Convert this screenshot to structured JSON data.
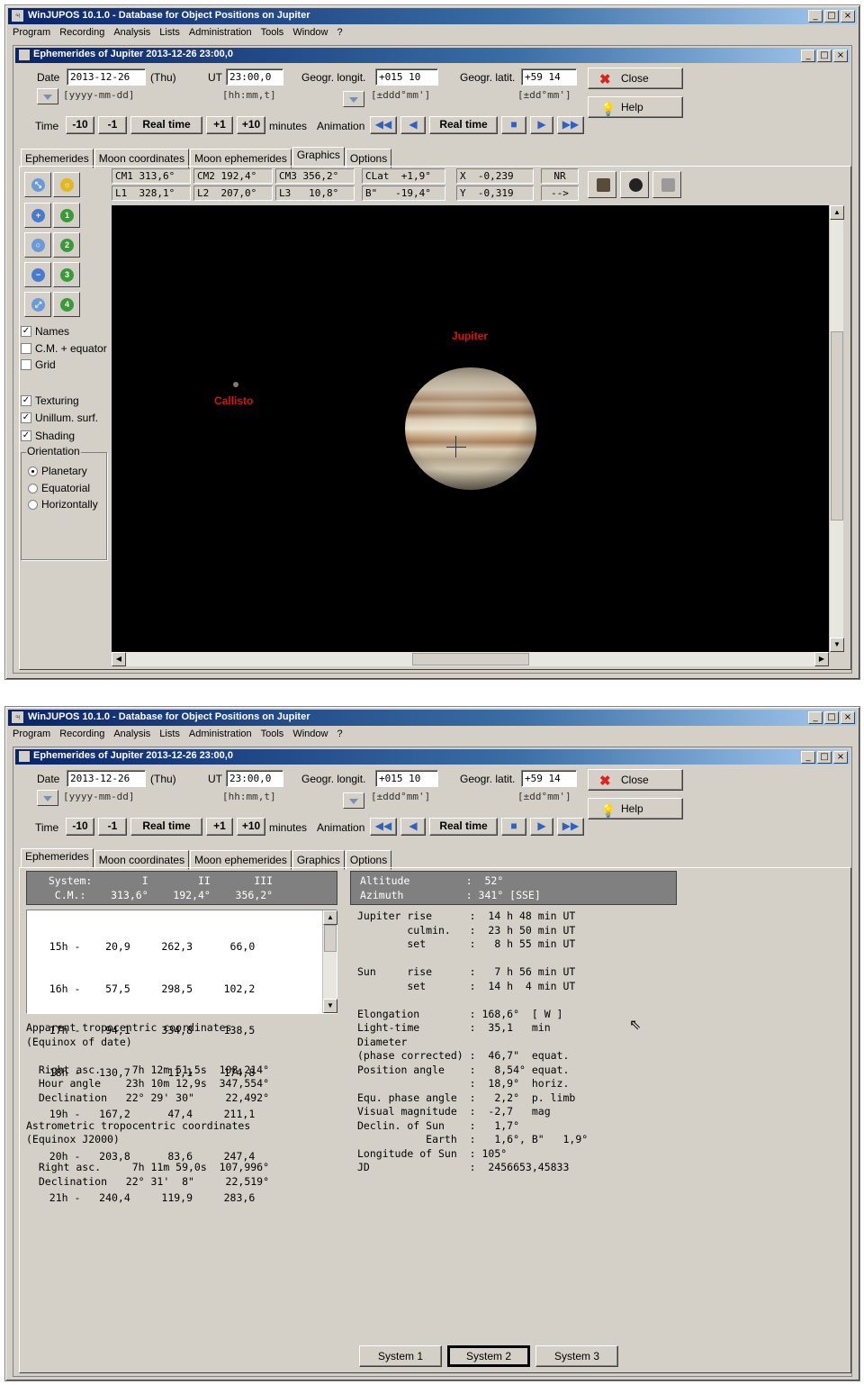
{
  "app": {
    "title": "WinJUPOS 10.1.0 - Database for Object Positions on Jupiter",
    "menu": [
      "Program",
      "Recording",
      "Analysis",
      "Lists",
      "Administration",
      "Tools",
      "Window",
      "?"
    ]
  },
  "child_title": "Ephemerides of Jupiter  2013-12-26  23:00,0",
  "form": {
    "date_label": "Date",
    "date_value": "2013-12-26",
    "weekday": "(Thu)",
    "date_hint": "[yyyy-mm-dd]",
    "ut_label": "UT",
    "ut_value": "23:00,0",
    "ut_hint": "[hh:mm,t]",
    "longit_label": "Geogr. longit.",
    "longit_value": "+015 10",
    "longit_hint": "[±ddd°mm']",
    "latit_label": "Geogr. latit.",
    "latit_value": "+59 14",
    "latit_hint": "[±dd°mm']",
    "close_label": "Close",
    "help_label": "Help",
    "time_label": "Time",
    "minus10": "-10",
    "minus1": "-1",
    "realtime": "Real time",
    "plus1": "+1",
    "plus10": "+10",
    "minutes_label": "minutes",
    "animation_label": "Animation",
    "anim_realtime": "Real time"
  },
  "tabs": [
    "Ephemerides",
    "Moon coordinates",
    "Moon ephemerides",
    "Graphics",
    "Options"
  ],
  "graphics": {
    "info_row1": [
      "CM1 313,6°",
      "CM2 192,4°",
      "CM3 356,2°",
      "CLat  +1,9°",
      "X  -0,239",
      "NR"
    ],
    "info_row2": [
      "L1  328,1°",
      "L2  207,0°",
      "L3   10,8°",
      "B\"   -19,4°",
      "Y  -0,319",
      "-->"
    ],
    "checks": [
      {
        "label": "Names",
        "checked": true
      },
      {
        "label": "C.M. + equator",
        "checked": false
      },
      {
        "label": "Grid",
        "checked": false
      }
    ],
    "checks2": [
      {
        "label": "Texturing",
        "checked": true
      },
      {
        "label": "Unillum. surf.",
        "checked": true
      },
      {
        "label": "Shading",
        "checked": true
      }
    ],
    "orientation_label": "Orientation",
    "orientations": [
      {
        "label": "Planetary",
        "selected": true
      },
      {
        "label": "Equatorial",
        "selected": false
      },
      {
        "label": "Horizontally",
        "selected": false
      }
    ],
    "jupiter_label": "Jupiter",
    "callisto_label": "Callisto",
    "label_color": "#e01010"
  },
  "ephem": {
    "system_header": "  System:        I        II       III\n   C.M.:    313,6°    192,4°    356,2°",
    "hour_rows": [
      "   15h -    20,9     262,3      66,0",
      "   16h -    57,5     298,5     102,2",
      "   17h -    94,1     334,8     138,5",
      "   18h -   130,7      11,1     174,8",
      "   19h -   167,2      47,4     211,1",
      "   20h -   203,8      83,6     247,4",
      "   21h -   240,4     119,9     283,6"
    ],
    "left_text": "Apparent tropocentric coordinates\n(Equinox of date)\n\n  Right asc.     7h 12m 51,5s  108,214°\n  Hour angle    23h 10m 12,9s  347,554°\n  Declination   22° 29' 30\"     22,492°\n\nAstrometric tropocentric coordinates\n(Equinox J2000)\n\n  Right asc.     7h 11m 59,0s  107,996°\n  Declination   22° 31'  8\"     22,519°",
    "altaz": "Altitude         :  52°\nAzimuth          : 341° [SSE]",
    "right_text": "Jupiter rise      :  14 h 48 min UT\n        culmin.   :  23 h 50 min UT\n        set       :   8 h 55 min UT\n\nSun     rise      :   7 h 56 min UT\n        set       :  14 h  4 min UT\n\nElongation        : 168,6°  [ W ]\nLight-time        :  35,1   min\nDiameter\n(phase corrected) :  46,7\"  equat.\nPosition angle    :   8,54° equat.\n                  :  18,9°  horiz.\nEqu. phase angle  :   2,2°  p. limb\nVisual magnitude  :  -2,7   mag\nDeclin. of Sun    :   1,7°\n           Earth  :   1,6°, B\"   1,9°\nLongitude of Sun  : 105°\nJD                :  2456653,45833",
    "system_buttons": [
      "System 1",
      "System 2",
      "System 3"
    ]
  }
}
